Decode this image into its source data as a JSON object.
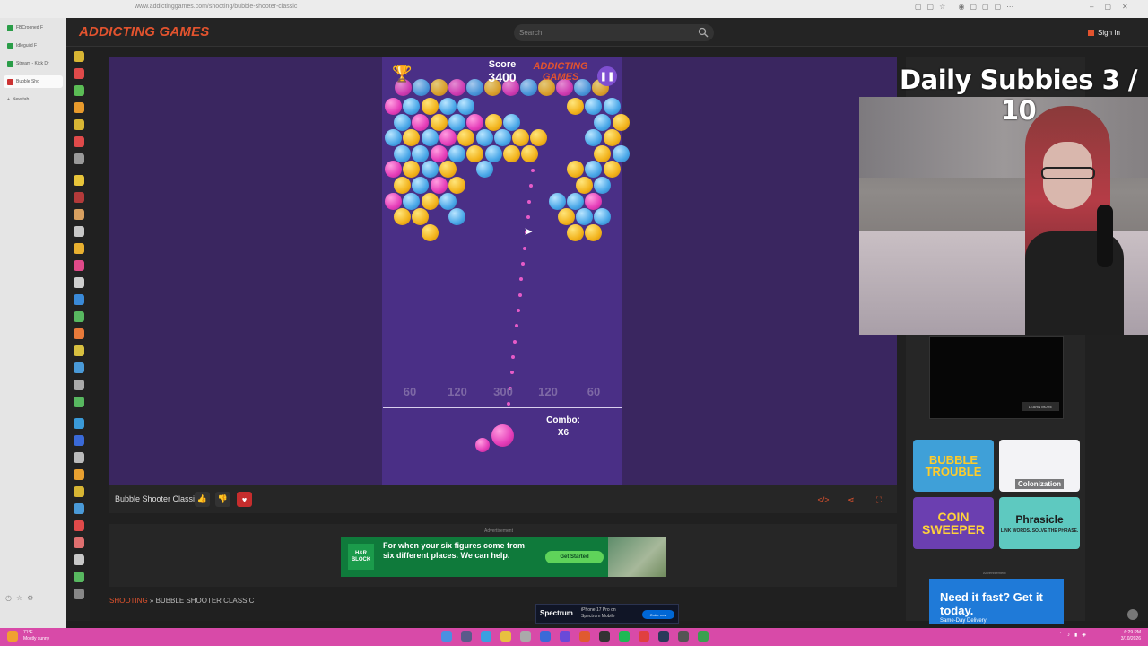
{
  "browser": {
    "url": "www.addictinggames.com/shooting/bubble-shooter-classic",
    "tabs": [
      {
        "label": "FBCrooned F"
      },
      {
        "label": "Idleguild F"
      },
      {
        "label": "Stream - Kick Dr"
      },
      {
        "label": "Bubble Sho",
        "active": true
      }
    ],
    "new_tab_label": "New tab"
  },
  "site": {
    "logo": "ADDICTING GAMES",
    "search_placeholder": "Search",
    "signin_label": "Sign In"
  },
  "game": {
    "score_label": "Score",
    "score_value": "3400",
    "in_game_logo": "ADDICTING GAMES",
    "zones": [
      "60",
      "120",
      "300",
      "120",
      "60"
    ],
    "combo_label": "Combo:",
    "combo_value": "X6",
    "title": "Bubble Shooter Classic"
  },
  "ads": {
    "label": "Advertisement",
    "hrblock_logo": "H&R BLOCK",
    "hrblock_text": "For when your six figures come from six different places. We can help.",
    "hrblock_cta": "Get Started",
    "spectrum_logo": "Spectrum",
    "spectrum_text": "iPhone 17 Pro on Spectrum Mobile",
    "spectrum_cta": "Order now",
    "video_cta": "LEARN MORE",
    "side_label": "Advertisement",
    "side_text": "Need it fast? Get it today.",
    "side_sub": "Same-Day Delivery"
  },
  "breadcrumb": {
    "category": "SHOOTING",
    "separator": "»",
    "current": "BUBBLE SHOOTER CLASSIC"
  },
  "stream": {
    "overlay_title": "Daily Subbies 3 / 10"
  },
  "related_games": [
    {
      "title": "BUBBLE TROUBLE"
    },
    {
      "title": "Colonization"
    },
    {
      "title": "COIN SWEEPER"
    },
    {
      "title": "Phrasicle",
      "tagline": "LINK WORDS. SOLVE THE PHRASE."
    }
  ],
  "taskbar": {
    "weather_temp": "71°F",
    "weather_desc": "Mostly sunny",
    "time": "6:29 PM",
    "date": "3/10/2026"
  },
  "colors": {
    "brand": "#e2532e",
    "game_bg": "#4a2f86",
    "taskbar": "#d84aa8",
    "bubble_yellow": "#f2b31c",
    "bubble_blue": "#49a7e8",
    "bubble_pink": "#e53db9"
  }
}
